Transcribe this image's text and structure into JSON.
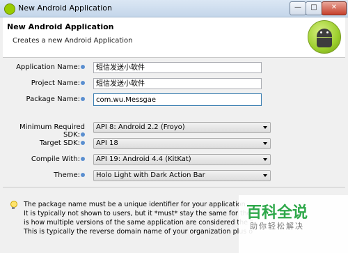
{
  "window": {
    "title": "New Android Application",
    "min_symbol": "—",
    "max_symbol": "□",
    "close_symbol": "✕"
  },
  "header": {
    "title": "New Android Application",
    "subtitle": "Creates a new Android Application",
    "logo_icon": "android-logo"
  },
  "form": {
    "app_name_label": "Application Name:",
    "app_name_value": "短信发送小软件",
    "project_name_label": "Project Name:",
    "project_name_value": "短信发送小软件",
    "package_name_label": "Package Name:",
    "package_name_value": "com.wu.Messgae",
    "min_sdk_label": "Minimum Required SDK:",
    "min_sdk_value": "API 8: Android 2.2 (Froyo)",
    "target_sdk_label": "Target SDK:",
    "target_sdk_value": "API 18",
    "compile_with_label": "Compile With:",
    "compile_with_value": "API 19: Android 4.4 (KitKat)",
    "theme_label": "Theme:",
    "theme_value": "Holo Light with Dark Action Bar"
  },
  "help": {
    "icon": "lightbulb-icon",
    "line1": "The package name must be a unique identifier for your application.",
    "line2": "It is typically not shown to users, but it *must* stay the same for the li",
    "line3": "is how multiple versions of the same application are considered the \"",
    "line4": "This is typically the reverse domain name of your organization plus o"
  },
  "watermark": {
    "title": "百科全说",
    "subtitle": "助你轻松解决"
  },
  "colors": {
    "android_green": "#9ccf2d",
    "watermark_green": "#2ea84a",
    "focus_border": "#3c7fb1"
  }
}
